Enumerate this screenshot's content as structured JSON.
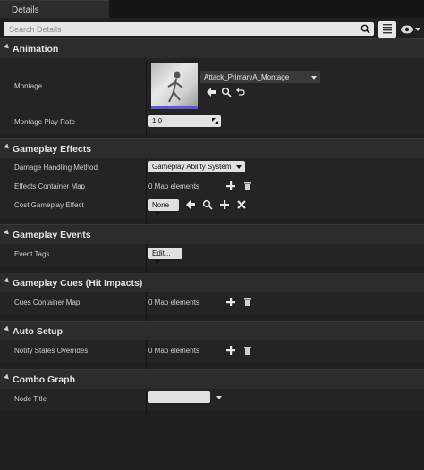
{
  "tab": {
    "title": "Details"
  },
  "search": {
    "placeholder": "Search Details"
  },
  "sections": {
    "animation": {
      "title": "Animation",
      "montage_label": "Montage",
      "montage_value": "Attack_PrimaryA_Montage",
      "play_rate_label": "Montage Play Rate",
      "play_rate_value": "1,0"
    },
    "gameplay_effects": {
      "title": "Gameplay Effects",
      "damage_label": "Damage Handling Method",
      "damage_value": "Gameplay Ability System",
      "container_label": "Effects Container Map",
      "container_value": "0 Map elements",
      "cost_label": "Cost Gameplay Effect",
      "cost_value": "None"
    },
    "gameplay_events": {
      "title": "Gameplay Events",
      "tags_label": "Event Tags",
      "tags_value": "Edit..."
    },
    "gameplay_cues": {
      "title": "Gameplay Cues (Hit Impacts)",
      "cues_label": "Cues Container Map",
      "cues_value": "0 Map elements"
    },
    "auto_setup": {
      "title": "Auto Setup",
      "notify_label": "Notify States Overrides",
      "notify_value": "0 Map elements"
    },
    "combo_graph": {
      "title": "Combo Graph",
      "node_label": "Node Title",
      "node_value": ""
    }
  },
  "icons": {
    "search": "search-icon",
    "view_options": "view-options-icon",
    "eye": "eye-icon",
    "add": "plus-icon",
    "delete": "trash-icon",
    "use": "arrow-left-icon",
    "browse": "magnifier-icon",
    "reset": "reset-icon",
    "clear": "x-icon"
  },
  "colors": {
    "thumbnail_accent": "#5a5ad8"
  }
}
